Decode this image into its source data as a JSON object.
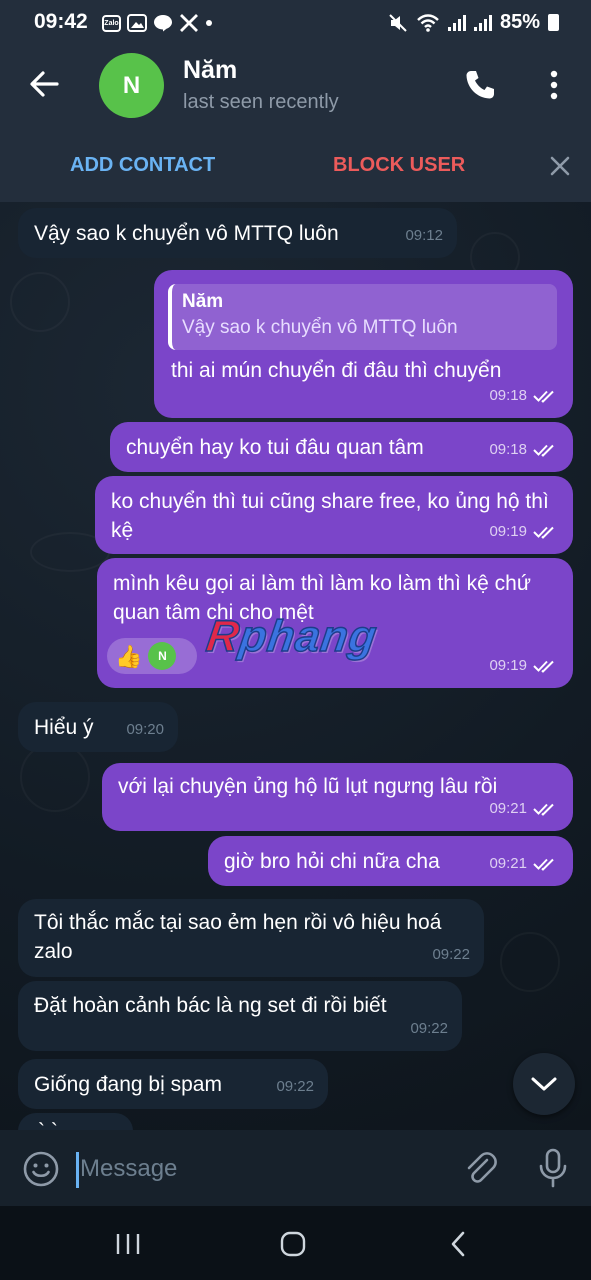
{
  "status_bar": {
    "time": "09:42",
    "zalo_label": "Zalo",
    "battery": "85%"
  },
  "header": {
    "avatar_initial": "N",
    "contact_name": "Năm",
    "last_seen": "last seen recently",
    "avatar_color": "#58c24a"
  },
  "action_bar": {
    "add_contact": "ADD CONTACT",
    "block_user": "BLOCK USER"
  },
  "messages": [
    {
      "direction": "in",
      "text": "Vậy sao k chuyển vô MTTQ luôn",
      "time": "09:12"
    },
    {
      "direction": "out",
      "reply_to": {
        "name": "Năm",
        "text": "Vậy sao k chuyển vô MTTQ luôn"
      },
      "text": "thi ai mún chuyển đi đâu thì chuyển",
      "time": "09:18",
      "read": true
    },
    {
      "direction": "out",
      "text": "chuyển hay ko tui đâu quan tâm",
      "time": "09:18",
      "read": true
    },
    {
      "direction": "out",
      "text": "ko chuyển thì tui cũng share free, ko ủng hộ thì kệ",
      "time": "09:19",
      "read": true
    },
    {
      "direction": "out",
      "text": "mình kêu gọi ai làm thì làm ko làm thì kệ chứ quan tâm chi cho mệt",
      "time": "09:19",
      "read": true,
      "reactions": {
        "emoji": "👍",
        "reactor_initial": "N"
      }
    },
    {
      "direction": "in",
      "text": "Hiểu ý",
      "time": "09:20"
    },
    {
      "direction": "out",
      "text": "với lại chuyện ủng hộ lũ lụt ngưng lâu rồi",
      "time": "09:21",
      "read": true
    },
    {
      "direction": "out",
      "text": "giờ bro hỏi chi nữa cha",
      "time": "09:21",
      "read": true
    },
    {
      "direction": "in",
      "text": "Tôi thắc mắc tại sao ẻm hẹn rồi vô hiệu hoá zalo",
      "time": "09:22"
    },
    {
      "direction": "in",
      "text": "Đặt hoàn cảnh bác là ng set đi rồi biết",
      "time": "09:22"
    },
    {
      "direction": "in",
      "text": "Giống đang bị spam",
      "time": "09:22"
    },
    {
      "direction": "in",
      "text": "` `",
      "time": ""
    }
  ],
  "watermark": {
    "first_letter": "R",
    "rest": "phang"
  },
  "input": {
    "placeholder": "Message"
  },
  "colors": {
    "outgoing_bubble": "#7b45c9",
    "incoming_bubble": "#182533",
    "header_bg": "#232e3c",
    "link_blue": "#6ab3f3",
    "block_red": "#ec5b5b"
  }
}
